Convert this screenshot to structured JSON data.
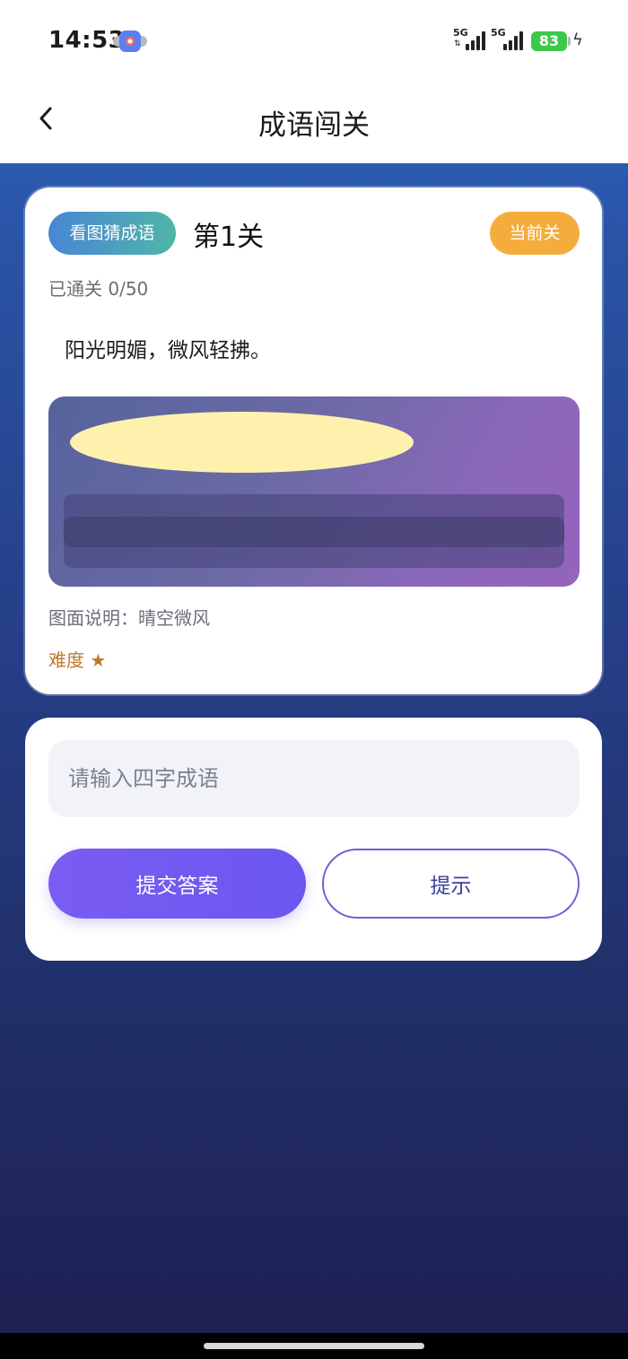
{
  "status_bar": {
    "time": "14:53",
    "network_1": "5G",
    "network_2": "5G",
    "battery": "83",
    "app_badge_icon": "app-icon",
    "charging_icon": "bolt-icon"
  },
  "nav": {
    "title": "成语闯关",
    "back_icon": "chevron-left-icon"
  },
  "level_card": {
    "mode_badge": "看图猜成语",
    "level_title": "第1关",
    "current_badge": "当前关",
    "progress": "已通关 0/50",
    "clue": "阳光明媚，微风轻拂。",
    "image_caption": "图面说明：晴空微风",
    "difficulty": "难度 ★",
    "colors": {
      "mode_badge_start": "#4a86d6",
      "mode_badge_end": "#4fb6a8",
      "current_badge": "#f4ad3d",
      "difficulty": "#c2782c",
      "sun": "#fdf1ad"
    }
  },
  "answer_card": {
    "input_placeholder": "请输入四字成语",
    "input_value": "",
    "submit_label": "提交答案",
    "hint_label": "提示",
    "colors": {
      "submit": "#6b57f0",
      "hint_border": "#6b62d6"
    }
  }
}
